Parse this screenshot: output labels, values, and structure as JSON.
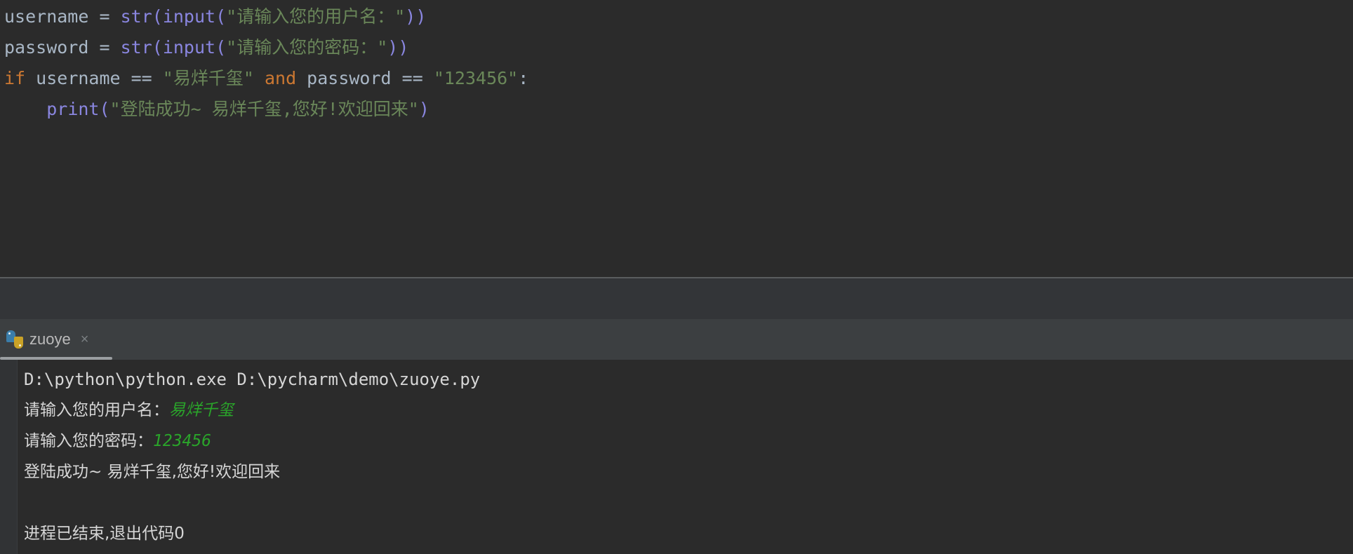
{
  "editor": {
    "name": "code-editor",
    "background": "#2b2b2b",
    "lines": [
      {
        "id": "line-1",
        "tokens": [
          {
            "text": "username",
            "kind": "t-var"
          },
          {
            "text": " ",
            "kind": "t-plain"
          },
          {
            "text": "=",
            "kind": "t-op"
          },
          {
            "text": " ",
            "kind": "t-plain"
          },
          {
            "text": "str",
            "kind": "t-builtin"
          },
          {
            "text": "(",
            "kind": "t-builtin"
          },
          {
            "text": "input",
            "kind": "t-builtin"
          },
          {
            "text": "(",
            "kind": "t-builtin"
          },
          {
            "text": "\"请输入您的用户名：\"",
            "kind": "t-string"
          },
          {
            "text": "))",
            "kind": "t-builtin"
          }
        ]
      },
      {
        "id": "line-2",
        "tokens": [
          {
            "text": "password",
            "kind": "t-var"
          },
          {
            "text": " ",
            "kind": "t-plain"
          },
          {
            "text": "=",
            "kind": "t-op"
          },
          {
            "text": " ",
            "kind": "t-plain"
          },
          {
            "text": "str",
            "kind": "t-builtin"
          },
          {
            "text": "(",
            "kind": "t-builtin"
          },
          {
            "text": "input",
            "kind": "t-builtin"
          },
          {
            "text": "(",
            "kind": "t-builtin"
          },
          {
            "text": "\"请输入您的密码：\"",
            "kind": "t-string"
          },
          {
            "text": "))",
            "kind": "t-builtin"
          }
        ]
      },
      {
        "id": "line-3",
        "tokens": [
          {
            "text": "if",
            "kind": "t-keyword"
          },
          {
            "text": " username ",
            "kind": "t-var"
          },
          {
            "text": "==",
            "kind": "t-op"
          },
          {
            "text": " ",
            "kind": "t-plain"
          },
          {
            "text": "\"易烊千玺\"",
            "kind": "t-string"
          },
          {
            "text": " ",
            "kind": "t-plain"
          },
          {
            "text": "and",
            "kind": "t-keyword"
          },
          {
            "text": " password ",
            "kind": "t-var"
          },
          {
            "text": "==",
            "kind": "t-op"
          },
          {
            "text": " ",
            "kind": "t-plain"
          },
          {
            "text": "\"123456\"",
            "kind": "t-string"
          },
          {
            "text": ":",
            "kind": "t-punct"
          }
        ]
      },
      {
        "id": "line-4",
        "tokens": [
          {
            "text": "    ",
            "kind": "t-plain"
          },
          {
            "text": "print",
            "kind": "t-func"
          },
          {
            "text": "(",
            "kind": "t-func"
          },
          {
            "text": "\"登陆成功~ 易烊千玺,您好!欢迎回来\"",
            "kind": "t-string"
          },
          {
            "text": ")",
            "kind": "t-func"
          }
        ]
      }
    ]
  },
  "run_tool_window": {
    "name": "run-tool-window",
    "tabs": [
      {
        "label": "zuoye",
        "icon": "python-file-icon",
        "close_label": "×",
        "active": true
      }
    ]
  },
  "console": {
    "name": "run-console",
    "background": "#2b2b2b",
    "text_color": "#d6d6d6",
    "input_echo_color": "#2aa52a",
    "lines": [
      {
        "id": "console-line-command",
        "type": "command",
        "text": "D:\\python\\python.exe D:\\pycharm\\demo\\zuoye.py"
      },
      {
        "id": "console-line-prompt-username",
        "type": "prompt-with-input",
        "prompt": "请输入您的用户名：",
        "input": "易烊千玺",
        "input_mono": false
      },
      {
        "id": "console-line-prompt-password",
        "type": "prompt-with-input",
        "prompt": "请输入您的密码：",
        "input": "123456",
        "input_mono": true
      },
      {
        "id": "console-line-result",
        "type": "output",
        "text": "登陆成功~ 易烊千玺,您好!欢迎回来"
      },
      {
        "id": "console-line-blank",
        "type": "blank",
        "text": ""
      },
      {
        "id": "console-line-exit",
        "type": "output",
        "text": "进程已结束,退出代码0"
      }
    ]
  },
  "colors": {
    "editor_bg": "#2b2b2b",
    "toolwindow_header_bg": "#333538",
    "tabbar_bg": "#3c3f41",
    "splitter": "#5a5d5e",
    "gutter": "#313335",
    "keyword": "#cc7832",
    "string": "#6a8759",
    "function": "#8a86e0",
    "identifier": "#a9b7c6",
    "tab_label": "#bbbbbb",
    "tab_underline": "#9a9ea1"
  }
}
